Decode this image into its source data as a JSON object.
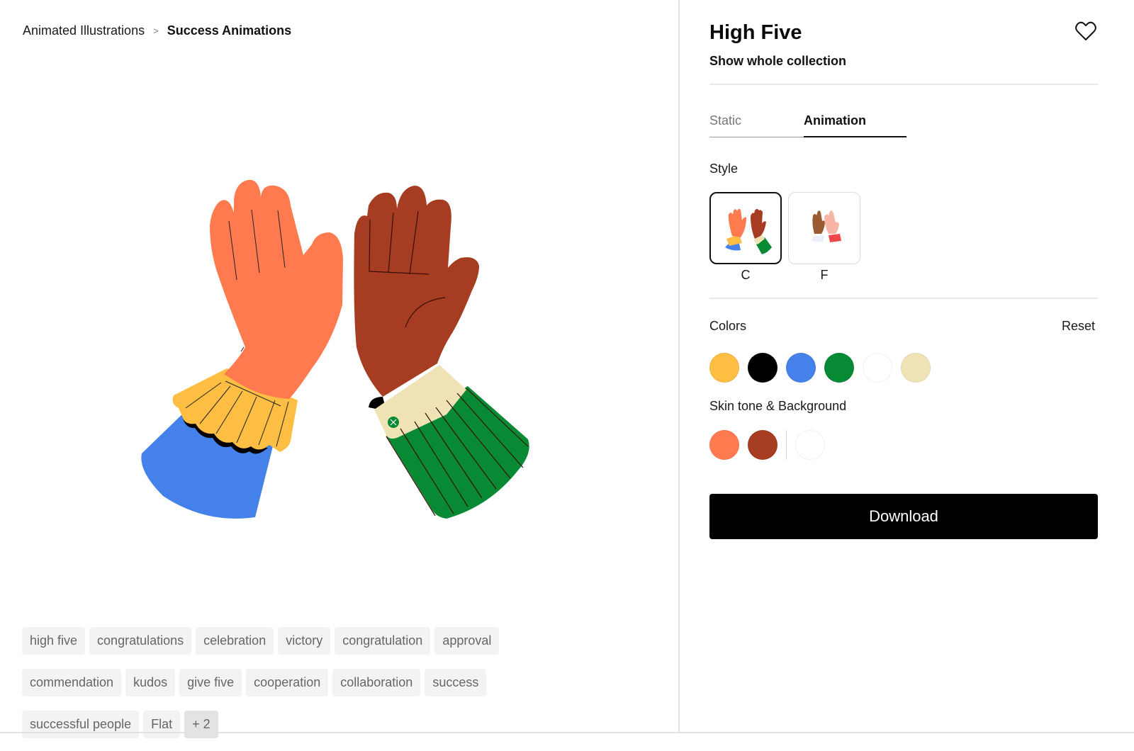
{
  "breadcrumb": {
    "items": [
      "Animated Illustrations",
      "Success Animations"
    ],
    "separator": ">"
  },
  "illustration": {
    "subject": "high-five-hands",
    "colors": {
      "left_skin": "#FF7B4F",
      "right_skin": "#A63C22",
      "left_cuff": "#FDBE43",
      "left_sleeve": "#4581EA",
      "right_cuff": "#EFE3B6",
      "right_sleeve": "#088A35",
      "outline": "#000000"
    }
  },
  "tags": [
    "high five",
    "congratulations",
    "celebration",
    "victory",
    "congratulation",
    "approval",
    "commendation",
    "kudos",
    "give five",
    "cooperation",
    "collaboration",
    "success",
    "successful people",
    "Flat"
  ],
  "tags_more": "+ 2",
  "details": {
    "title": "High Five",
    "favorite_icon": "heart-outline-icon",
    "collection_link": "Show whole collection",
    "tabs": [
      {
        "label": "Static",
        "active": false
      },
      {
        "label": "Animation",
        "active": true
      }
    ],
    "style_label": "Style",
    "styles": [
      {
        "caption": "C",
        "selected": true
      },
      {
        "caption": "F",
        "selected": false
      }
    ],
    "colors_label": "Colors",
    "reset_label": "Reset",
    "colors": [
      "#FDBE43",
      "#000000",
      "#4581EA",
      "#088A35",
      "#FFFFFF",
      "#EFE3B6"
    ],
    "skin_label": "Skin tone & Background",
    "skin_tones": [
      "#FF7B4F",
      "#A63C22"
    ],
    "background": "#FFFFFF",
    "download_label": "Download"
  }
}
